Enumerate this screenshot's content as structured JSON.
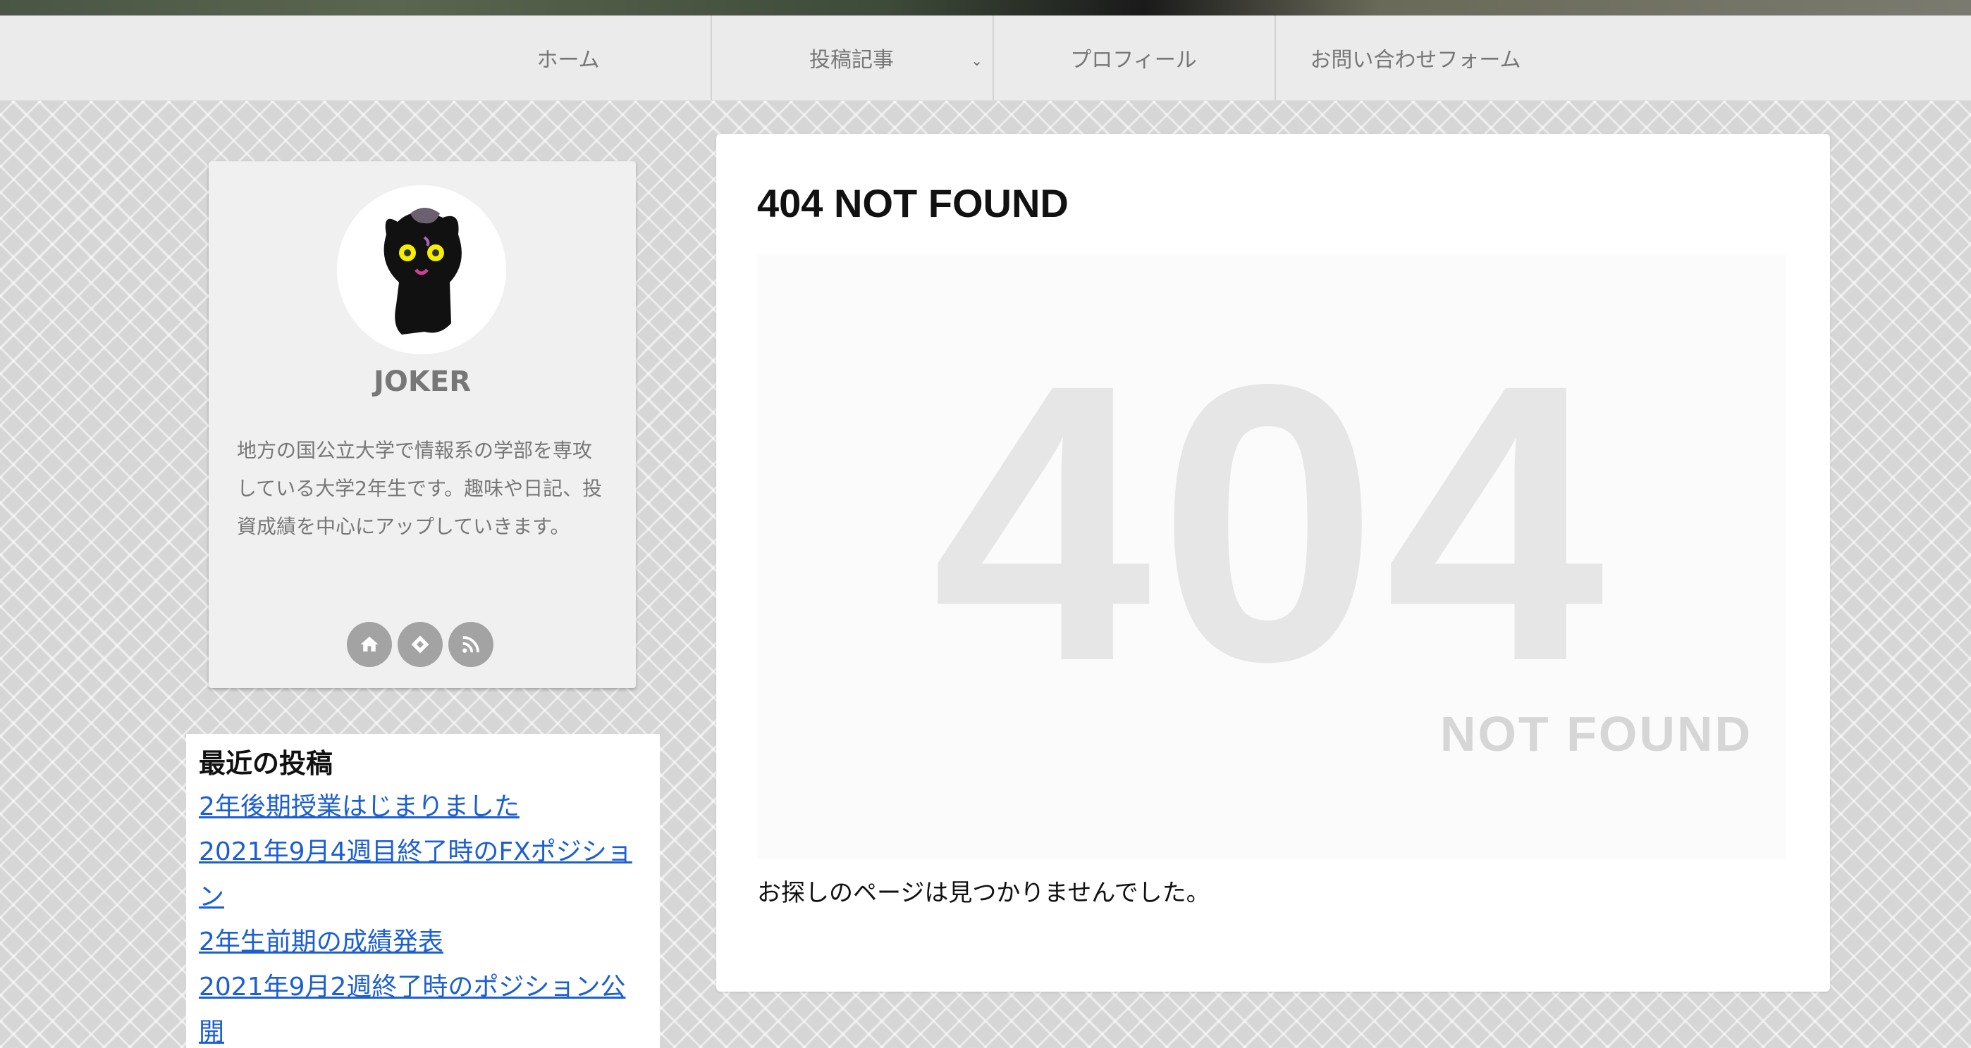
{
  "nav": {
    "items": [
      {
        "label": "ホーム"
      },
      {
        "label": "投稿記事",
        "has_dropdown": true
      },
      {
        "label": "プロフィール"
      },
      {
        "label": "お問い合わせフォーム"
      }
    ]
  },
  "profile": {
    "name": "JOKER",
    "description": "地方の国公立大学で情報系の学部を専攻している大学2年生です。趣味や日記、投資成績を中心にアップしていきます。",
    "social_icons": [
      "home-icon",
      "feedly-icon",
      "rss-icon"
    ]
  },
  "recent_posts": {
    "title": "最近の投稿",
    "items": [
      "2年後期授業はじまりました",
      "2021年9月4週目終了時のFXポジション",
      "2年生前期の成績発表",
      "2021年9月2週終了時のポジション公開"
    ]
  },
  "main": {
    "title": "404 NOT FOUND",
    "image_big_text": "404",
    "image_small_text": "NOT FOUND",
    "message": "お探しのページは見つかりませんでした。"
  },
  "colors": {
    "nav_bg": "#ebebeb",
    "link": "#1c5fd1",
    "icon_bg": "#a3a3a3"
  }
}
